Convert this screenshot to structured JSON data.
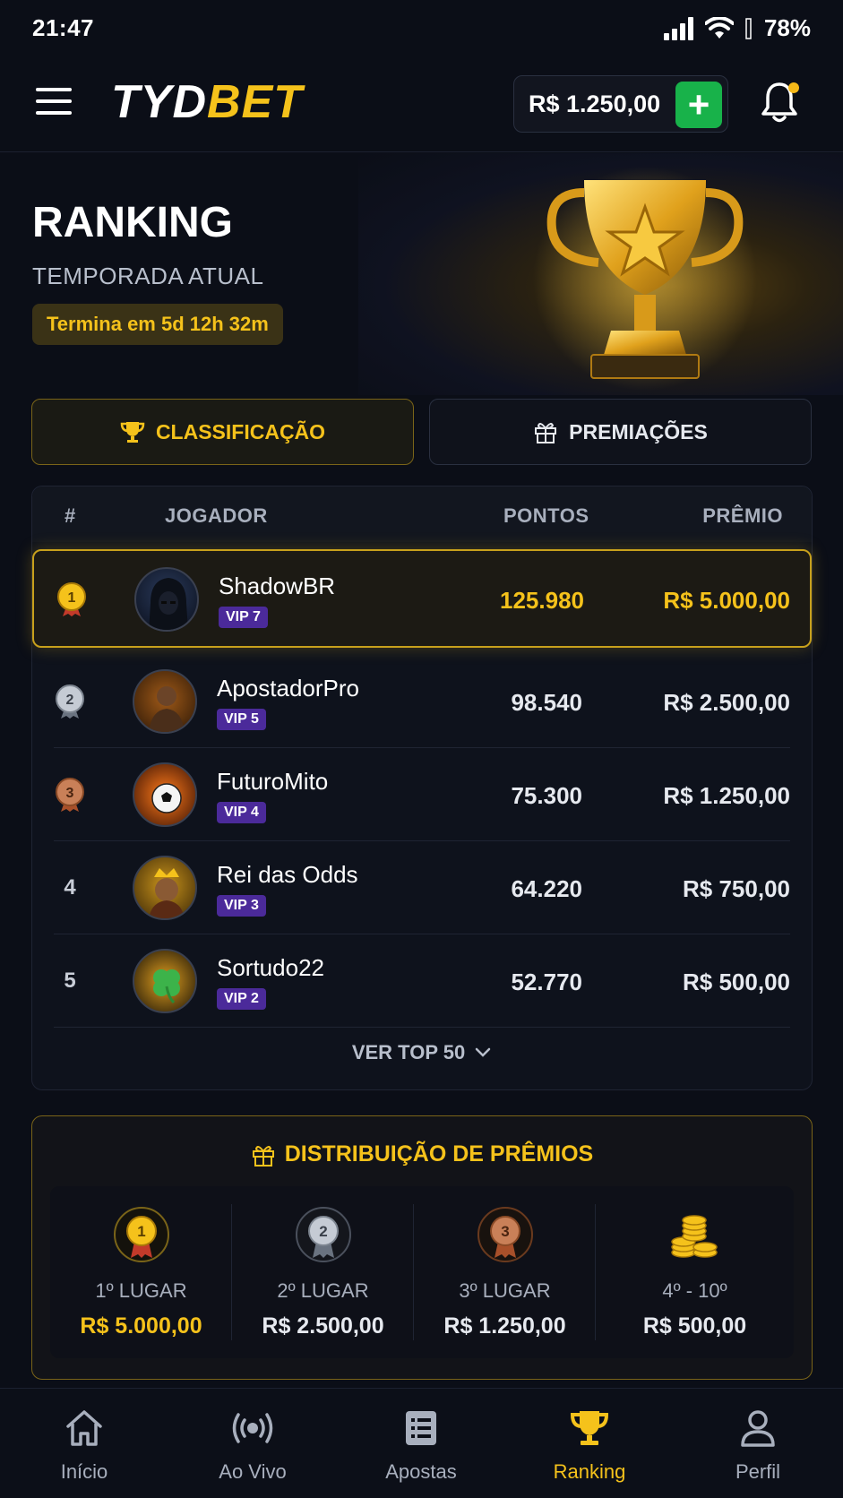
{
  "status_bar": {
    "time": "21:47",
    "battery": "78%"
  },
  "header": {
    "logo_part1": "TYD",
    "logo_part2": "BET",
    "balance": "R$ 1.250,00",
    "add_label": "+"
  },
  "hero": {
    "title": "RANKING",
    "subtitle": "TEMPORADA ATUAL",
    "countdown": "Termina em 5d 12h 32m"
  },
  "tabs": [
    {
      "label": "CLASSIFICAÇÃO",
      "active": true
    },
    {
      "label": "PREMIAÇÕES",
      "active": false
    }
  ],
  "table": {
    "headers": {
      "rank": "#",
      "player": "JOGADOR",
      "points": "PONTOS",
      "prize": "PRÊMIO"
    },
    "rows": [
      {
        "rank": "1",
        "name": "ShadowBR",
        "vip": "VIP 7",
        "points": "125.980",
        "prize": "R$ 5.000,00"
      },
      {
        "rank": "2",
        "name": "ApostadorPro",
        "vip": "VIP 5",
        "points": "98.540",
        "prize": "R$ 2.500,00"
      },
      {
        "rank": "3",
        "name": "FuturoMito",
        "vip": "VIP 4",
        "points": "75.300",
        "prize": "R$ 1.250,00"
      },
      {
        "rank": "4",
        "name": "Rei das Odds",
        "vip": "VIP 3",
        "points": "64.220",
        "prize": "R$ 750,00"
      },
      {
        "rank": "5",
        "name": "Sortudo22",
        "vip": "VIP 2",
        "points": "52.770",
        "prize": "R$ 500,00"
      }
    ],
    "more_label": "VER TOP 50"
  },
  "distribution": {
    "title": "DISTRIBUIÇÃO DE PRÊMIOS",
    "items": [
      {
        "label": "1º LUGAR",
        "value": "R$ 5.000,00",
        "medal": "1"
      },
      {
        "label": "2º LUGAR",
        "value": "R$ 2.500,00",
        "medal": "2"
      },
      {
        "label": "3º LUGAR",
        "value": "R$ 1.250,00",
        "medal": "3"
      },
      {
        "label": "4º - 10º",
        "value": "R$ 500,00"
      }
    ]
  },
  "bottom_nav": [
    {
      "label": "Início",
      "icon": "home-icon"
    },
    {
      "label": "Ao Vivo",
      "icon": "live-icon"
    },
    {
      "label": "Apostas",
      "icon": "bets-icon"
    },
    {
      "label": "Ranking",
      "icon": "trophy-icon",
      "active": true
    },
    {
      "label": "Perfil",
      "icon": "user-icon"
    }
  ],
  "colors": {
    "accent": "#f5c21b",
    "background": "#0b0e17",
    "vip": "#4b2a9a",
    "add_button": "#18b24a"
  }
}
